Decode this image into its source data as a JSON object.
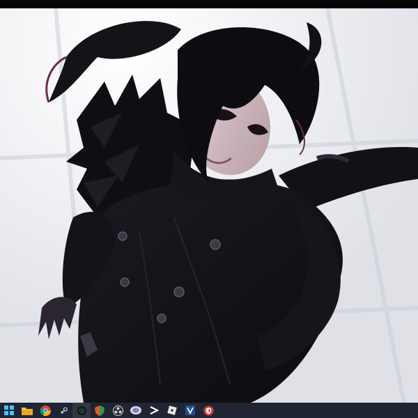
{
  "taskbar": {
    "apps": [
      {
        "icon": "start-icon"
      },
      {
        "icon": "file-explorer-icon"
      },
      {
        "icon": "chrome-icon"
      },
      {
        "icon": "steam-icon"
      },
      {
        "icon": "game-app-icon"
      },
      {
        "icon": "shield-app-icon"
      },
      {
        "icon": "obs-icon"
      },
      {
        "icon": "app-icon"
      },
      {
        "icon": "capcut-icon"
      },
      {
        "icon": "roblox-icon"
      },
      {
        "icon": "vegas-icon"
      },
      {
        "icon": "shield-badge-icon"
      }
    ],
    "background": "#202533"
  }
}
